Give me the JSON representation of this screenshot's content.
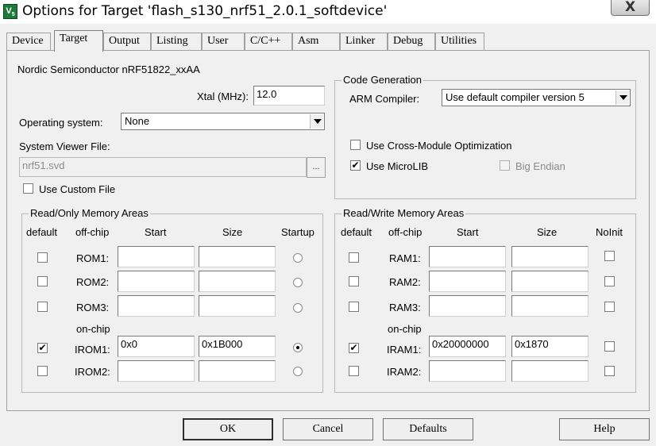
{
  "window": {
    "title": "Options for Target 'flash_s130_nrf51_2.0.1_softdevice'",
    "close_glyph": "X"
  },
  "tabs": [
    "Device",
    "Target",
    "Output",
    "Listing",
    "User",
    "C/C++",
    "Asm",
    "Linker",
    "Debug",
    "Utilities"
  ],
  "active_tab": "Target",
  "device_name": "Nordic Semiconductor nRF51822_xxAA",
  "xtal": {
    "label": "Xtal (MHz):",
    "value": "12.0"
  },
  "os": {
    "label": "Operating system:",
    "value": "None"
  },
  "svd": {
    "label": "System Viewer File:",
    "value": "nrf51.svd",
    "browse": "..."
  },
  "custom_file": {
    "label": "Use Custom File",
    "checked": false
  },
  "codegen": {
    "title": "Code Generation",
    "compiler_label": "ARM Compiler:",
    "compiler_value": "Use default compiler version 5",
    "cross_module": {
      "label": "Use Cross-Module Optimization",
      "checked": false
    },
    "microlib": {
      "label": "Use MicroLIB",
      "checked": true
    },
    "big_endian": {
      "label": "Big Endian",
      "checked": false
    }
  },
  "rom": {
    "title": "Read/Only Memory Areas",
    "headers": {
      "default": "default",
      "offchip": "off-chip",
      "start": "Start",
      "size": "Size",
      "startup": "Startup"
    },
    "onchip_label": "on-chip",
    "rows": [
      {
        "name": "ROM1:",
        "default": false,
        "start": "",
        "size": "",
        "startup": false
      },
      {
        "name": "ROM2:",
        "default": false,
        "start": "",
        "size": "",
        "startup": false
      },
      {
        "name": "ROM3:",
        "default": false,
        "start": "",
        "size": "",
        "startup": false
      },
      {
        "name": "IROM1:",
        "default": true,
        "start": "0x0",
        "size": "0x1B000",
        "startup": true
      },
      {
        "name": "IROM2:",
        "default": false,
        "start": "",
        "size": "",
        "startup": false
      }
    ]
  },
  "ram": {
    "title": "Read/Write Memory Areas",
    "headers": {
      "default": "default",
      "offchip": "off-chip",
      "start": "Start",
      "size": "Size",
      "noinit": "NoInit"
    },
    "onchip_label": "on-chip",
    "rows": [
      {
        "name": "RAM1:",
        "default": false,
        "start": "",
        "size": "",
        "noinit": false
      },
      {
        "name": "RAM2:",
        "default": false,
        "start": "",
        "size": "",
        "noinit": false
      },
      {
        "name": "RAM3:",
        "default": false,
        "start": "",
        "size": "",
        "noinit": false
      },
      {
        "name": "IRAM1:",
        "default": true,
        "start": "0x20000000",
        "size": "0x1870",
        "noinit": false
      },
      {
        "name": "IRAM2:",
        "default": false,
        "start": "",
        "size": "",
        "noinit": false
      }
    ]
  },
  "buttons": {
    "ok": "OK",
    "cancel": "Cancel",
    "defaults": "Defaults",
    "help": "Help"
  },
  "check_glyph": "✔"
}
